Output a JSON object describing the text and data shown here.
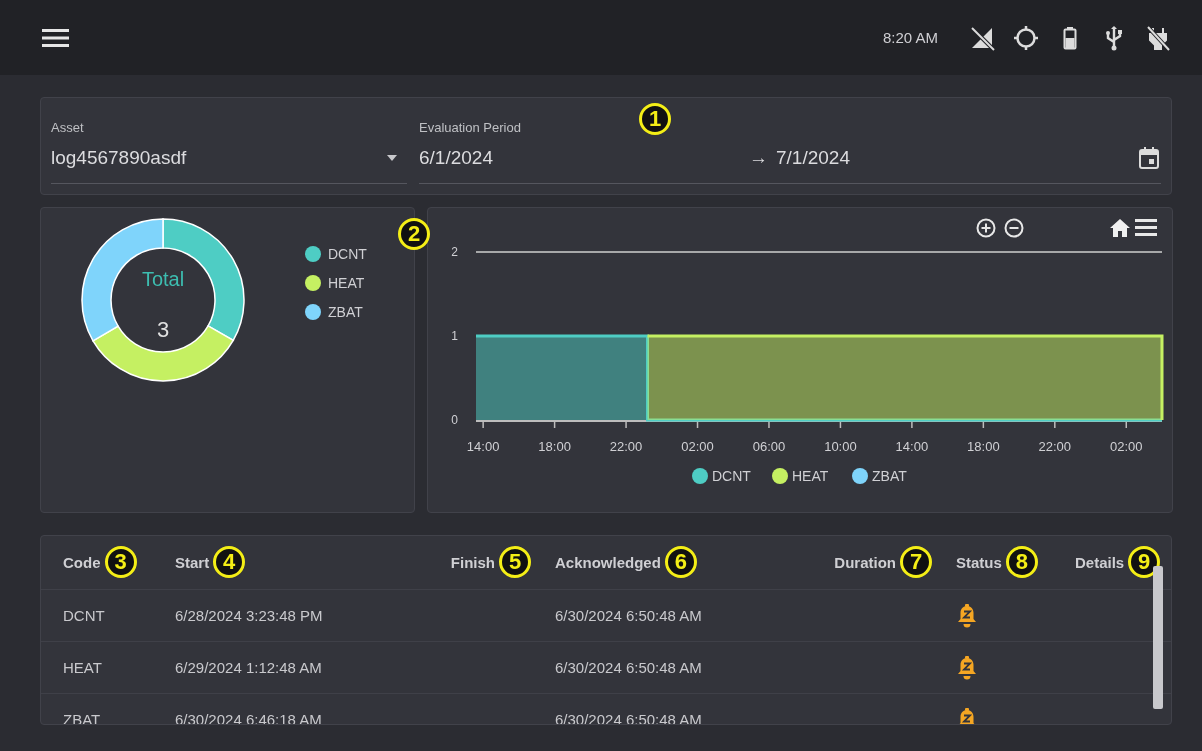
{
  "top_bar": {
    "time": "8:20 AM"
  },
  "filters": {
    "callout": "1",
    "asset": {
      "label": "Asset",
      "value": "log4567890asdf"
    },
    "period": {
      "label": "Evaluation Period",
      "start": "6/1/2024",
      "arrow": "→",
      "end": "7/1/2024"
    }
  },
  "summary": {
    "center_label": "Total",
    "center_value": "3",
    "chart_data": {
      "type": "donut",
      "categories": [
        "DCNT",
        "HEAT",
        "ZBAT"
      ],
      "colors": [
        "#4ecdc4",
        "#c5f062",
        "#7fd4fb"
      ],
      "values": [
        33.3,
        33.3,
        33.4
      ],
      "legend": "right"
    }
  },
  "timeline": {
    "callout": "2",
    "chart_data": {
      "type": "area",
      "legend": "bottom",
      "x": [
        "2024-06-28T13:36",
        "2024-06-28T23:12",
        "2024-06-28T23:12",
        "2024-06-30T04:00",
        "2024-06-30T04:00"
      ],
      "xlim": [
        "2024-06-28T13:36",
        "2024-06-30T04:00"
      ],
      "ylim": [
        0,
        2
      ],
      "yticks": [
        0,
        1,
        2
      ],
      "xticks": [
        {
          "value": "2024-06-28T14:00",
          "label": "14:00"
        },
        {
          "value": "2024-06-28T18:00",
          "label": "18:00"
        },
        {
          "value": "2024-06-28T22:00",
          "label": "22:00"
        },
        {
          "value": "2024-06-29T02:00",
          "label": "02:00"
        },
        {
          "value": "2024-06-29T06:00",
          "label": "06:00"
        },
        {
          "value": "2024-06-29T10:00",
          "label": "10:00"
        },
        {
          "value": "2024-06-29T14:00",
          "label": "14:00"
        },
        {
          "value": "2024-06-29T18:00",
          "label": "18:00"
        },
        {
          "value": "2024-06-29T22:00",
          "label": "22:00"
        },
        {
          "value": "2024-06-30T02:00",
          "label": "02:00"
        }
      ],
      "series": [
        {
          "name": "DCNT",
          "color": "#4ecdc4",
          "values": [
            1,
            1,
            0,
            0,
            null
          ]
        },
        {
          "name": "HEAT",
          "color": "#c5f062",
          "values": [
            null,
            null,
            1,
            1,
            0
          ]
        },
        {
          "name": "ZBAT",
          "color": "#7fd4fb",
          "values": [
            null,
            null,
            null,
            null,
            null
          ]
        }
      ]
    }
  },
  "table": {
    "columns": [
      {
        "label": "Code",
        "callout": "3"
      },
      {
        "label": "Start",
        "callout": "4"
      },
      {
        "label": "Finish",
        "callout": "5"
      },
      {
        "label": "Acknowledged",
        "callout": "6"
      },
      {
        "label": "Duration",
        "callout": "7"
      },
      {
        "label": "Status",
        "callout": "8"
      },
      {
        "label": "Details",
        "callout": "9"
      }
    ],
    "rows": [
      {
        "code": "DCNT",
        "start": "6/28/2024 3:23:48 PM",
        "acknowledged": "6/30/2024 6:50:48 AM"
      },
      {
        "code": "HEAT",
        "start": "6/29/2024 1:12:48 AM",
        "acknowledged": "6/30/2024 6:50:48 AM"
      },
      {
        "code": "ZBAT",
        "start": "6/30/2024 6:46:18 AM",
        "acknowledged": "6/30/2024 6:50:48 AM"
      }
    ]
  }
}
